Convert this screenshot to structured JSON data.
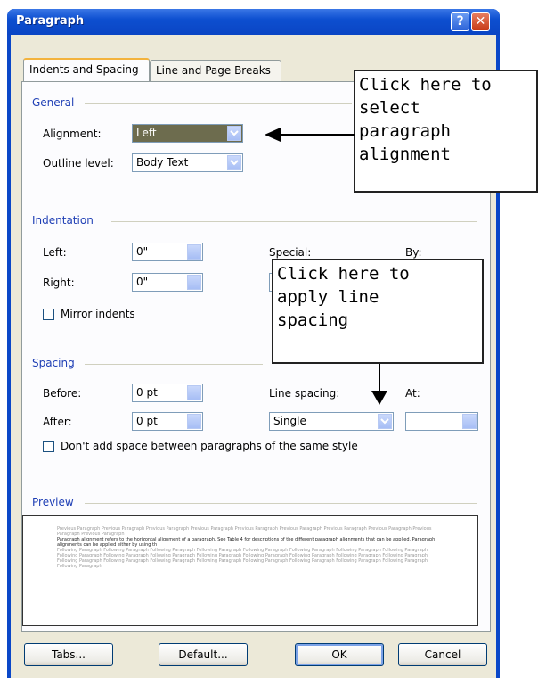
{
  "dialog": {
    "title": "Paragraph",
    "help_glyph": "?",
    "close_glyph": "✕"
  },
  "tabs": [
    {
      "label": "Indents and Spacing"
    },
    {
      "label": "Line and Page Breaks"
    }
  ],
  "general": {
    "heading": "General",
    "alignment_label": "Alignment:",
    "alignment_value": "Left",
    "outline_label": "Outline level:",
    "outline_value": "Body Text"
  },
  "indentation": {
    "heading": "Indentation",
    "left_label": "Left:",
    "left_value": "0\"",
    "right_label": "Right:",
    "right_value": "0\"",
    "special_label": "Special:",
    "by_label": "By:",
    "mirror_label": "Mirror indents"
  },
  "spacing": {
    "heading": "Spacing",
    "before_label": "Before:",
    "before_value": "0 pt",
    "after_label": "After:",
    "after_value": "0 pt",
    "line_spacing_label": "Line spacing:",
    "line_spacing_value": "Single",
    "at_label": "At:",
    "dont_add_label": "Don't add space between paragraphs of the same style"
  },
  "preview": {
    "heading": "Preview",
    "prev_text": "Previous Paragraph Previous Paragraph Previous Paragraph Previous Paragraph Previous Paragraph Previous Paragraph Previous Paragraph Previous Paragraph Previous Paragraph Previous Paragraph",
    "body_text": "Paragraph alignment refers to the horizontal alignment of a paragraph. See Table 4 for descriptions of the different paragraph alignments that can be applied. Paragraph alignments can be applied either by using th",
    "next_text": "Following Paragraph Following Paragraph Following Paragraph Following Paragraph Following Paragraph Following Paragraph Following Paragraph Following Paragraph Following Paragraph Following Paragraph Following Paragraph Following Paragraph Following Paragraph Following Paragraph Following Paragraph Following Paragraph Following Paragraph Following Paragraph Following Paragraph Following Paragraph Following Paragraph Following Paragraph Following Paragraph Following Paragraph Following Paragraph"
  },
  "buttons": {
    "tabs": "Tabs...",
    "default": "Default...",
    "ok": "OK",
    "cancel": "Cancel"
  },
  "callouts": {
    "alignment": "Click here to\nselect\nparagraph\nalignment",
    "line_spacing": "Click here to\napply line\nspacing"
  },
  "colors": {
    "titlebar": "#0a47c8",
    "section_heading": "#1f3fb5",
    "selected_field": "#6d6c4e",
    "dialog_face": "#ece9d8"
  },
  "icons": {
    "dropdown": "chevron-down-icon",
    "spinner": "spinner-icon"
  }
}
